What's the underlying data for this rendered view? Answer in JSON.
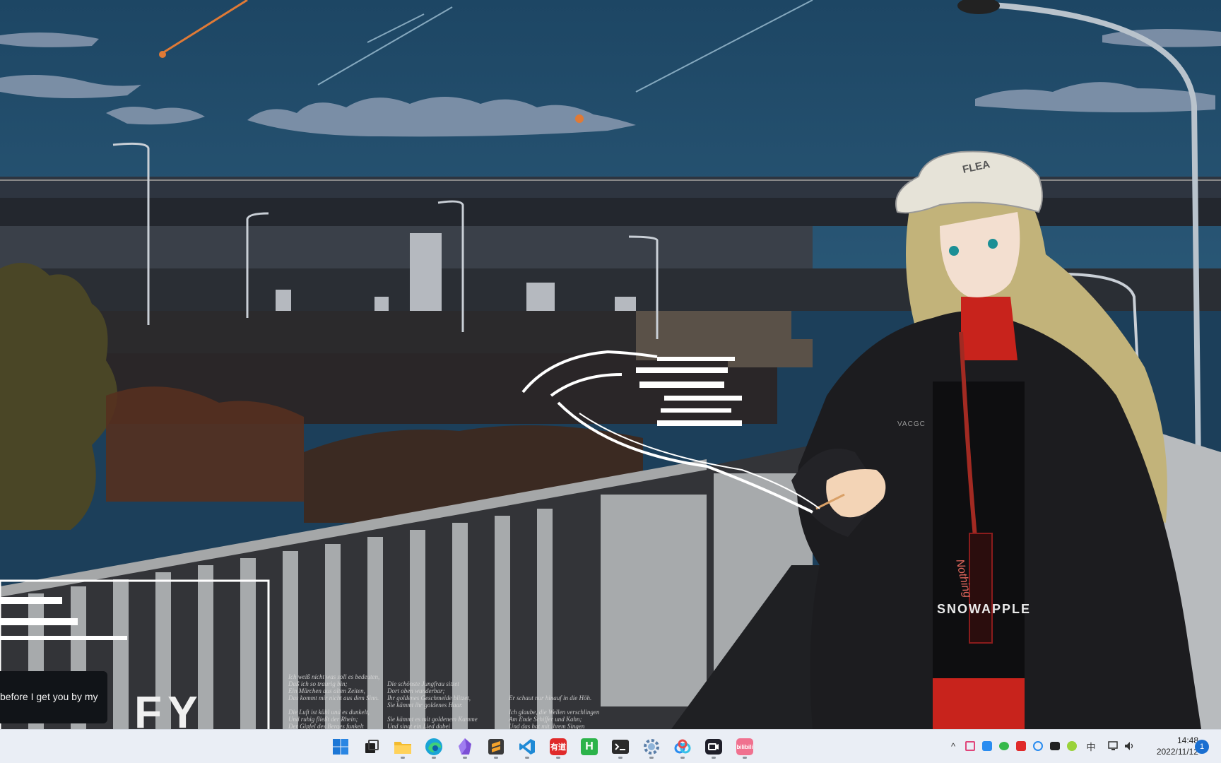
{
  "wallpaper": {
    "jacket_print": "SNOWAPPLE",
    "tag_text": "Nothing",
    "cap_text": "FLEA",
    "logo_text": "VACGC",
    "title_fragment": "FY",
    "lyrics": [
      "Ich weiß nicht was soll es bedeuten,\nDaß ich so traurig bin;\nEin Märchen aus alten Zeiten,\nDas kommt mir nicht aus dem Sinn.\n\nDie Luft ist kühl und es dunkelt,\nUnd ruhig fließt der Rhein;\nDer Gipfel des Berges funkelt",
      "Die schönste Jungfrau sitzet\nDort oben wunderbar;\nIhr goldenes Geschmeide blitzet,\nSie kämmt ihr goldenes Haar.\n\nSie kämmt es mit goldenem Kamme\nUnd singt ein Lied dabei",
      "Er schaut nur hinauf in die Höh.\n\nIch glaube, die Wellen verschlingen\nAm Ende Schiffer und Kahn;\nUnd das hat mit ihrem Singen"
    ]
  },
  "toast": {
    "text": "before I get you by my"
  },
  "taskbar": {
    "apps": [
      {
        "name": "start-button",
        "icon": "windows-logo-icon",
        "label": "Start",
        "running": false
      },
      {
        "name": "taskview-button",
        "icon": "task-view-icon",
        "label": "Task View",
        "running": false
      },
      {
        "name": "file-explorer-button",
        "icon": "folder-icon",
        "label": "File Explorer",
        "running": true
      },
      {
        "name": "edge-button",
        "icon": "edge-icon",
        "label": "Microsoft Edge",
        "running": true
      },
      {
        "name": "obsidian-button",
        "icon": "obsidian-icon",
        "label": "Obsidian",
        "running": true
      },
      {
        "name": "sublime-button",
        "icon": "sublime-icon",
        "label": "Sublime Text",
        "running": true
      },
      {
        "name": "vscode-button",
        "icon": "vscode-icon",
        "label": "Visual Studio Code",
        "running": true
      },
      {
        "name": "youdao-button",
        "icon": "youdao-icon",
        "label": "有道",
        "running": true
      },
      {
        "name": "hbuilder-button",
        "icon": "hbuilder-icon",
        "label": "H",
        "running": false
      },
      {
        "name": "terminal-button",
        "icon": "terminal-icon",
        "label": "Terminal",
        "running": true
      },
      {
        "name": "settings-app-button",
        "icon": "gear-icon",
        "label": "Settings",
        "running": true
      },
      {
        "name": "baidu-netdisk-button",
        "icon": "cloud-icon",
        "label": "Netdisk",
        "running": true
      },
      {
        "name": "capture-button",
        "icon": "video-camera-icon",
        "label": "Capture",
        "running": true
      },
      {
        "name": "bilibili-button",
        "icon": "bilibili-icon",
        "label": "bilibili",
        "running": true
      }
    ],
    "tray": {
      "overflow": "^",
      "icons": [
        "calendar-tray-icon",
        "star-tray-icon",
        "wechat-tray-icon",
        "red-app-tray-icon",
        "netdisk-tray-icon",
        "camera-tray-icon",
        "green-app-tray-icon"
      ],
      "ime": "中",
      "time": "14:48",
      "date": "2022/11/12",
      "notifications": "1"
    }
  },
  "colors": {
    "sky": "#1e4a68",
    "taskbar": "#eaeef5",
    "accent": "#1a6fd1",
    "jacket": "#1c1c1f",
    "shirt": "#c8231c",
    "hair": "#c2b37a"
  }
}
